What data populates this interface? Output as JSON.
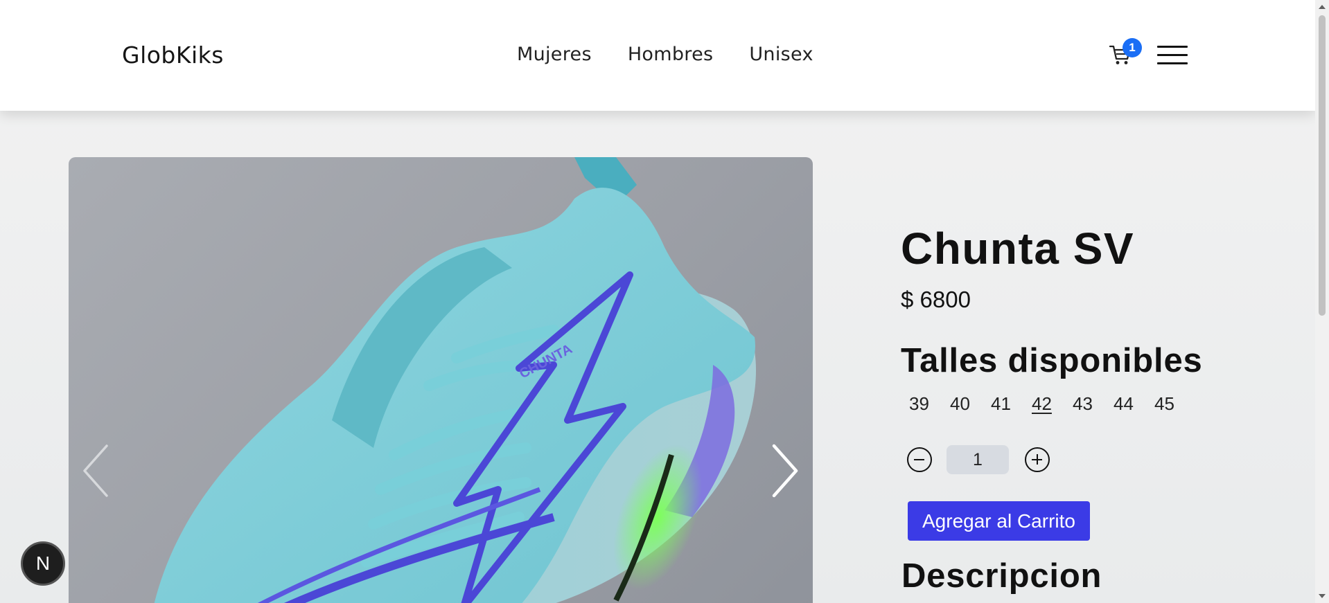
{
  "header": {
    "brand": "GlobKiks",
    "nav": [
      "Mujeres",
      "Hombres",
      "Unisex"
    ],
    "cart_count": "1",
    "cart_icon": "cart-icon",
    "menu_icon": "hamburger-menu-icon"
  },
  "product": {
    "name": "Chunta SV",
    "price": "$ 6800",
    "sizes_title": "Talles disponibles",
    "sizes": [
      "39",
      "40",
      "41",
      "42",
      "43",
      "44",
      "45"
    ],
    "selected_size": "42",
    "quantity": "1",
    "add_to_cart": "Agregar al Carrito",
    "description_title": "Descripcion",
    "shoe_brand_text": "CHUNTA"
  },
  "floating_badge": "N",
  "colors": {
    "accent": "#3b3be6",
    "badge": "#1a6ef5",
    "qty_bg": "#d7dbe1"
  }
}
